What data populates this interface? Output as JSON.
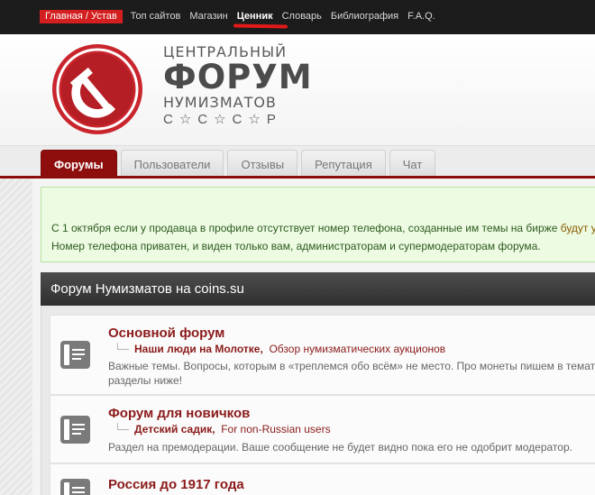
{
  "topnav": {
    "items": [
      {
        "label": "Главная / Устав",
        "active": true
      },
      {
        "label": "Топ сайтов"
      },
      {
        "label": "Магазин"
      },
      {
        "label": "Ценник",
        "highlight": true
      },
      {
        "label": "Словарь"
      },
      {
        "label": "Библиография"
      },
      {
        "label": "F.A.Q."
      }
    ]
  },
  "logo": {
    "line1": "ЦЕНТРАЛЬНЫЙ",
    "line2": "ФОРУМ",
    "line3": "НУМИЗМАТОВ",
    "line4": "С☆С☆С☆Р"
  },
  "tabs": [
    "Форумы",
    "Пользователи",
    "Отзывы",
    "Репутация",
    "Чат"
  ],
  "notice": {
    "line1": "С 1 октября если у продавца в профиле отсутствует номер телефона, созданные им темы на бирже ",
    "line1_tail": "будут у",
    "line2": "Номер телефона приватен, и виден только вам, администраторам и супермодераторам форума."
  },
  "forum_section": {
    "title": "Форум Нумизматов на coins.su",
    "forums": [
      {
        "title": "Основной форум",
        "subforums": [
          "Наши люди на Молотке,",
          "Обзор нумизматических аукционов"
        ],
        "description": [
          "Важные темы. Вопросы, которым в «треплемся обо всём» не место. Про монеты пишем в темат",
          "разделы ниже!"
        ]
      },
      {
        "title": "Форум для новичков",
        "subforums": [
          "Детский садик,",
          "For non-Russian users"
        ],
        "description": [
          "Раздел на премодерации. Ваше сообщение не будет видно пока его не одобрит модератор."
        ]
      },
      {
        "title": "Россия до 1917 года",
        "subforums": [],
        "description": []
      }
    ]
  },
  "colors": {
    "brand_red": "#8e0e0e",
    "active_nav": "#d31f1f",
    "notice_bg": "#ecfbe2"
  }
}
